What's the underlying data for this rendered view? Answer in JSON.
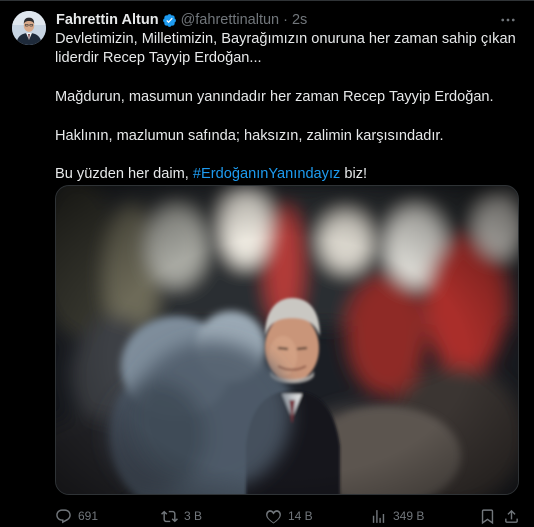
{
  "author": {
    "display_name": "Fahrettin Altun",
    "handle": "@fahrettinaltun",
    "separator": "·",
    "time": "2s",
    "verified": true
  },
  "tweet": {
    "p1_line1": "Devletimizin, Milletimizin, Bayrağımızın onuruna her zaman sahip çıkan",
    "p1_line2": "liderdir Recep Tayyip Erdoğan...",
    "p2": "Mağdurun, masumun yanındadır her zaman Recep Tayyip Erdoğan.",
    "p3": "Haklının, mazlumun safında; haksızın, zalimin karşısındadır.",
    "p4_text": "Bu yüzden her daim, ",
    "p4_hashtag": "#ErdoğanınYanındayız",
    "p4_end": " biz!"
  },
  "actions": {
    "replies": "691",
    "retweets": "3 B",
    "likes": "14 B",
    "views": "349 B"
  },
  "colors": {
    "background": "#000000",
    "text": "#e7e9ea",
    "muted": "#71767b",
    "link": "#1d9bf0",
    "verified_badge": "#1d9bf0",
    "border": "#2f3336"
  },
  "icons": [
    "verified-badge-icon",
    "more-icon",
    "reply-icon",
    "retweet-icon",
    "like-icon",
    "views-icon",
    "bookmark-icon",
    "share-icon"
  ]
}
